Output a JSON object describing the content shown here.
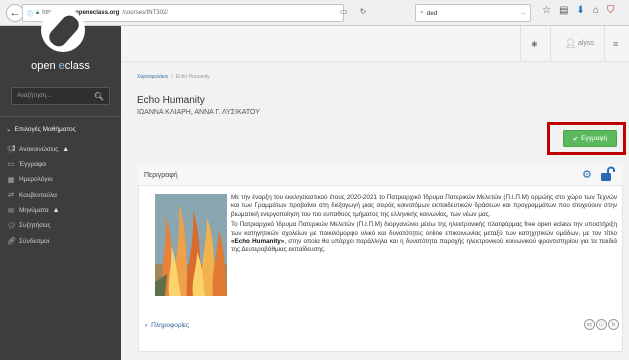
{
  "browser": {
    "url_prefix": "https://free.",
    "url_domain": "openeclass.org",
    "url_path": "/courses/INT302/",
    "search_text": "ded"
  },
  "sidebar": {
    "logo_pre": "open ",
    "logo_e": "e",
    "logo_post": "class",
    "search_placeholder": "Αναζήτηση...",
    "section_title": "Επιλογές Μαθήματος",
    "items": [
      {
        "label": "Ανακοινώσεις",
        "icon": "bullhorn-icon",
        "warn": true
      },
      {
        "label": "Έγγραφα",
        "icon": "folder-icon",
        "warn": false
      },
      {
        "label": "Ημερολόγιο",
        "icon": "calendar-icon",
        "warn": false
      },
      {
        "label": "Κουβεντούλα",
        "icon": "exchange-icon",
        "warn": false
      },
      {
        "label": "Μηνύματα",
        "icon": "envelope-icon",
        "warn": true
      },
      {
        "label": "Συζητήσεις",
        "icon": "comments-icon",
        "warn": false
      },
      {
        "label": "Σύνδεσμοι",
        "icon": "link-icon",
        "warn": false
      }
    ]
  },
  "topbar": {
    "user": "alyss"
  },
  "breadcrumb": {
    "home": "Χαρτοφυλάκιο",
    "sep": "/",
    "current": "Echo Humanity"
  },
  "course": {
    "title": "Echo Humanity",
    "teachers": "ΙΩΑΝΝΑ ΚΛΙΑΡΗ, ΑΝΝΑ Γ. ΛΥΣΙΚΑΤΟΥ",
    "register_label": "Εγγραφή"
  },
  "card": {
    "title": "Περιγραφή",
    "para1": "Με την έναρξη του εκκλησιαστικού έτους 2020-2021 το Πατριαρχικό Ίδρυμα Πατερικών Μελετών (Π.Ι.Π.Μ) ορμώης στο χώρο των Τεχνών και των Γραμμάτων προβαίνει στη διεξαγωγή μιας σειράς καινοτόμων εκπαιδευτικών δράσεων και προγραμμάτων που στοχεύουν στην βιωματική ενεργοποίηση του πιο ευπαθούς τμήματος της ελληνικής κοινωνίας, των νέων μας.",
    "para2_a": "Το Πατριαρχικό Ίδρυμα Πατερικών Μελετών (Π.Ι.Π.Μ) διοργανώνει μέσω της ηλεκτρονικής πλατφόρμας free open eclass την υποστήριξη των κατηγητικών σχολείων με ποικιλόμορφο υλικό και δυνατότητες online επικοινωνίας μεταξύ των κατηχητικών ομάδων, με τον τίτλο ",
    "para2_b": "«Echo Humanity»",
    "para2_c": ", στην οποία θα υπάρχει παράλληλα και η δυνατότητα παροχής ηλεκτρονικού κοινωνικού φροντιστηρίου για τα παιδιά της Δευτεροβάθμιας εκπαίδευσης.",
    "info_label": "Πληροφορίες"
  },
  "colors": {
    "sidebar_bg": "#3d3d3d",
    "register_green": "#5cb85c",
    "highlight_red": "#c00000",
    "link_blue": "#2b5d8f"
  }
}
